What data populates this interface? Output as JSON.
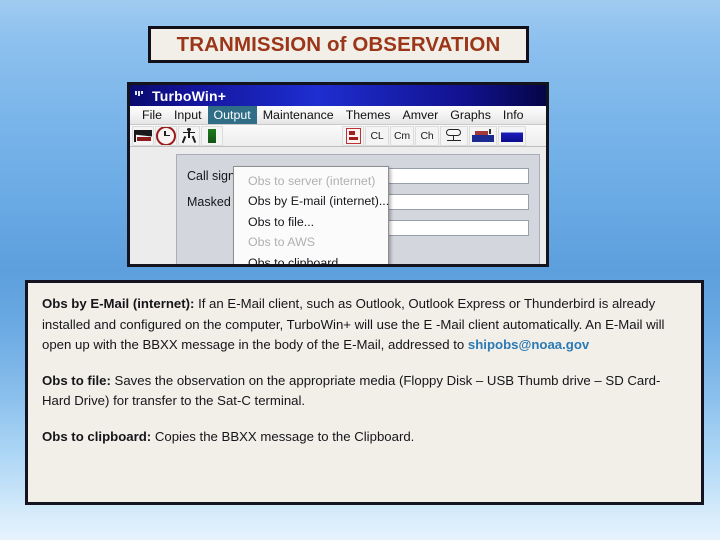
{
  "slide": {
    "title": "TRANMISSION of OBSERVATION"
  },
  "app_window": {
    "titlebar": {
      "icon": "app-icon",
      "title": "TurboWin+"
    },
    "menubar": [
      {
        "label": "File",
        "active": false
      },
      {
        "label": "Input",
        "active": false
      },
      {
        "label": "Output",
        "active": true
      },
      {
        "label": "Maintenance",
        "active": false
      },
      {
        "label": "Themes",
        "active": false
      },
      {
        "label": "Amver",
        "active": false
      },
      {
        "label": "Graphs",
        "active": false
      },
      {
        "label": "Info",
        "active": false
      }
    ],
    "toolbar": [
      {
        "icon": "flag-icon",
        "label": ""
      },
      {
        "icon": "clock-icon",
        "label": ""
      },
      {
        "icon": "anemometer-icon",
        "label": ""
      },
      {
        "icon": "green-strip-icon",
        "label": ""
      },
      {
        "icon": "red-chart-icon",
        "label": ""
      },
      {
        "icon": "cloud-low-icon",
        "label": "CL"
      },
      {
        "icon": "cloud-mid-icon",
        "label": "Cm"
      },
      {
        "icon": "cloud-high-icon",
        "label": "Ch"
      },
      {
        "icon": "cloud-icon",
        "label": ""
      },
      {
        "icon": "ship-icon",
        "label": ""
      },
      {
        "icon": "sea-state-icon",
        "label": ""
      }
    ],
    "dropdown": {
      "items": [
        {
          "label": "Obs to server (internet)",
          "disabled": true
        },
        {
          "label": "Obs by E-mail (internet)...",
          "disabled": false
        },
        {
          "label": "Obs to file...",
          "disabled": false
        },
        {
          "label": "Obs to AWS",
          "disabled": true
        },
        {
          "label": "Obs to clipboard",
          "disabled": false
        }
      ]
    },
    "form": {
      "fields": [
        {
          "label": "Call sign",
          "value": ""
        },
        {
          "label": "Masked call sign",
          "value": ""
        }
      ]
    }
  },
  "body": {
    "paragraphs": [
      {
        "heading": "Obs by E-Mail (internet):",
        "text": " If an E-Mail client, such as Outlook, Outlook Express or Thunderbird is already installed and configured on the computer, TurboWin+ will use the E -Mail client automatically.  An E-Mail will open up with the BBXX message in the body of the E-Mail, addressed to ",
        "email": "shipobs@noaa.gov"
      },
      {
        "heading": "Obs to file:",
        "text": "  Saves the observation on the appropriate media (Floppy Disk – USB Thumb drive – SD Card- Hard Drive) for transfer to the Sat-C terminal.",
        "email": ""
      },
      {
        "heading": "Obs to clipboard:",
        "text": "  Copies the BBXX message to the Clipboard.",
        "email": ""
      }
    ]
  },
  "colors": {
    "title_text": "#9c3618",
    "banner_bg": "#f2efe9",
    "menu_active_bg": "#2f6e86",
    "email_link": "#2a7ab5",
    "textbox_bg": "#f2efe9"
  }
}
